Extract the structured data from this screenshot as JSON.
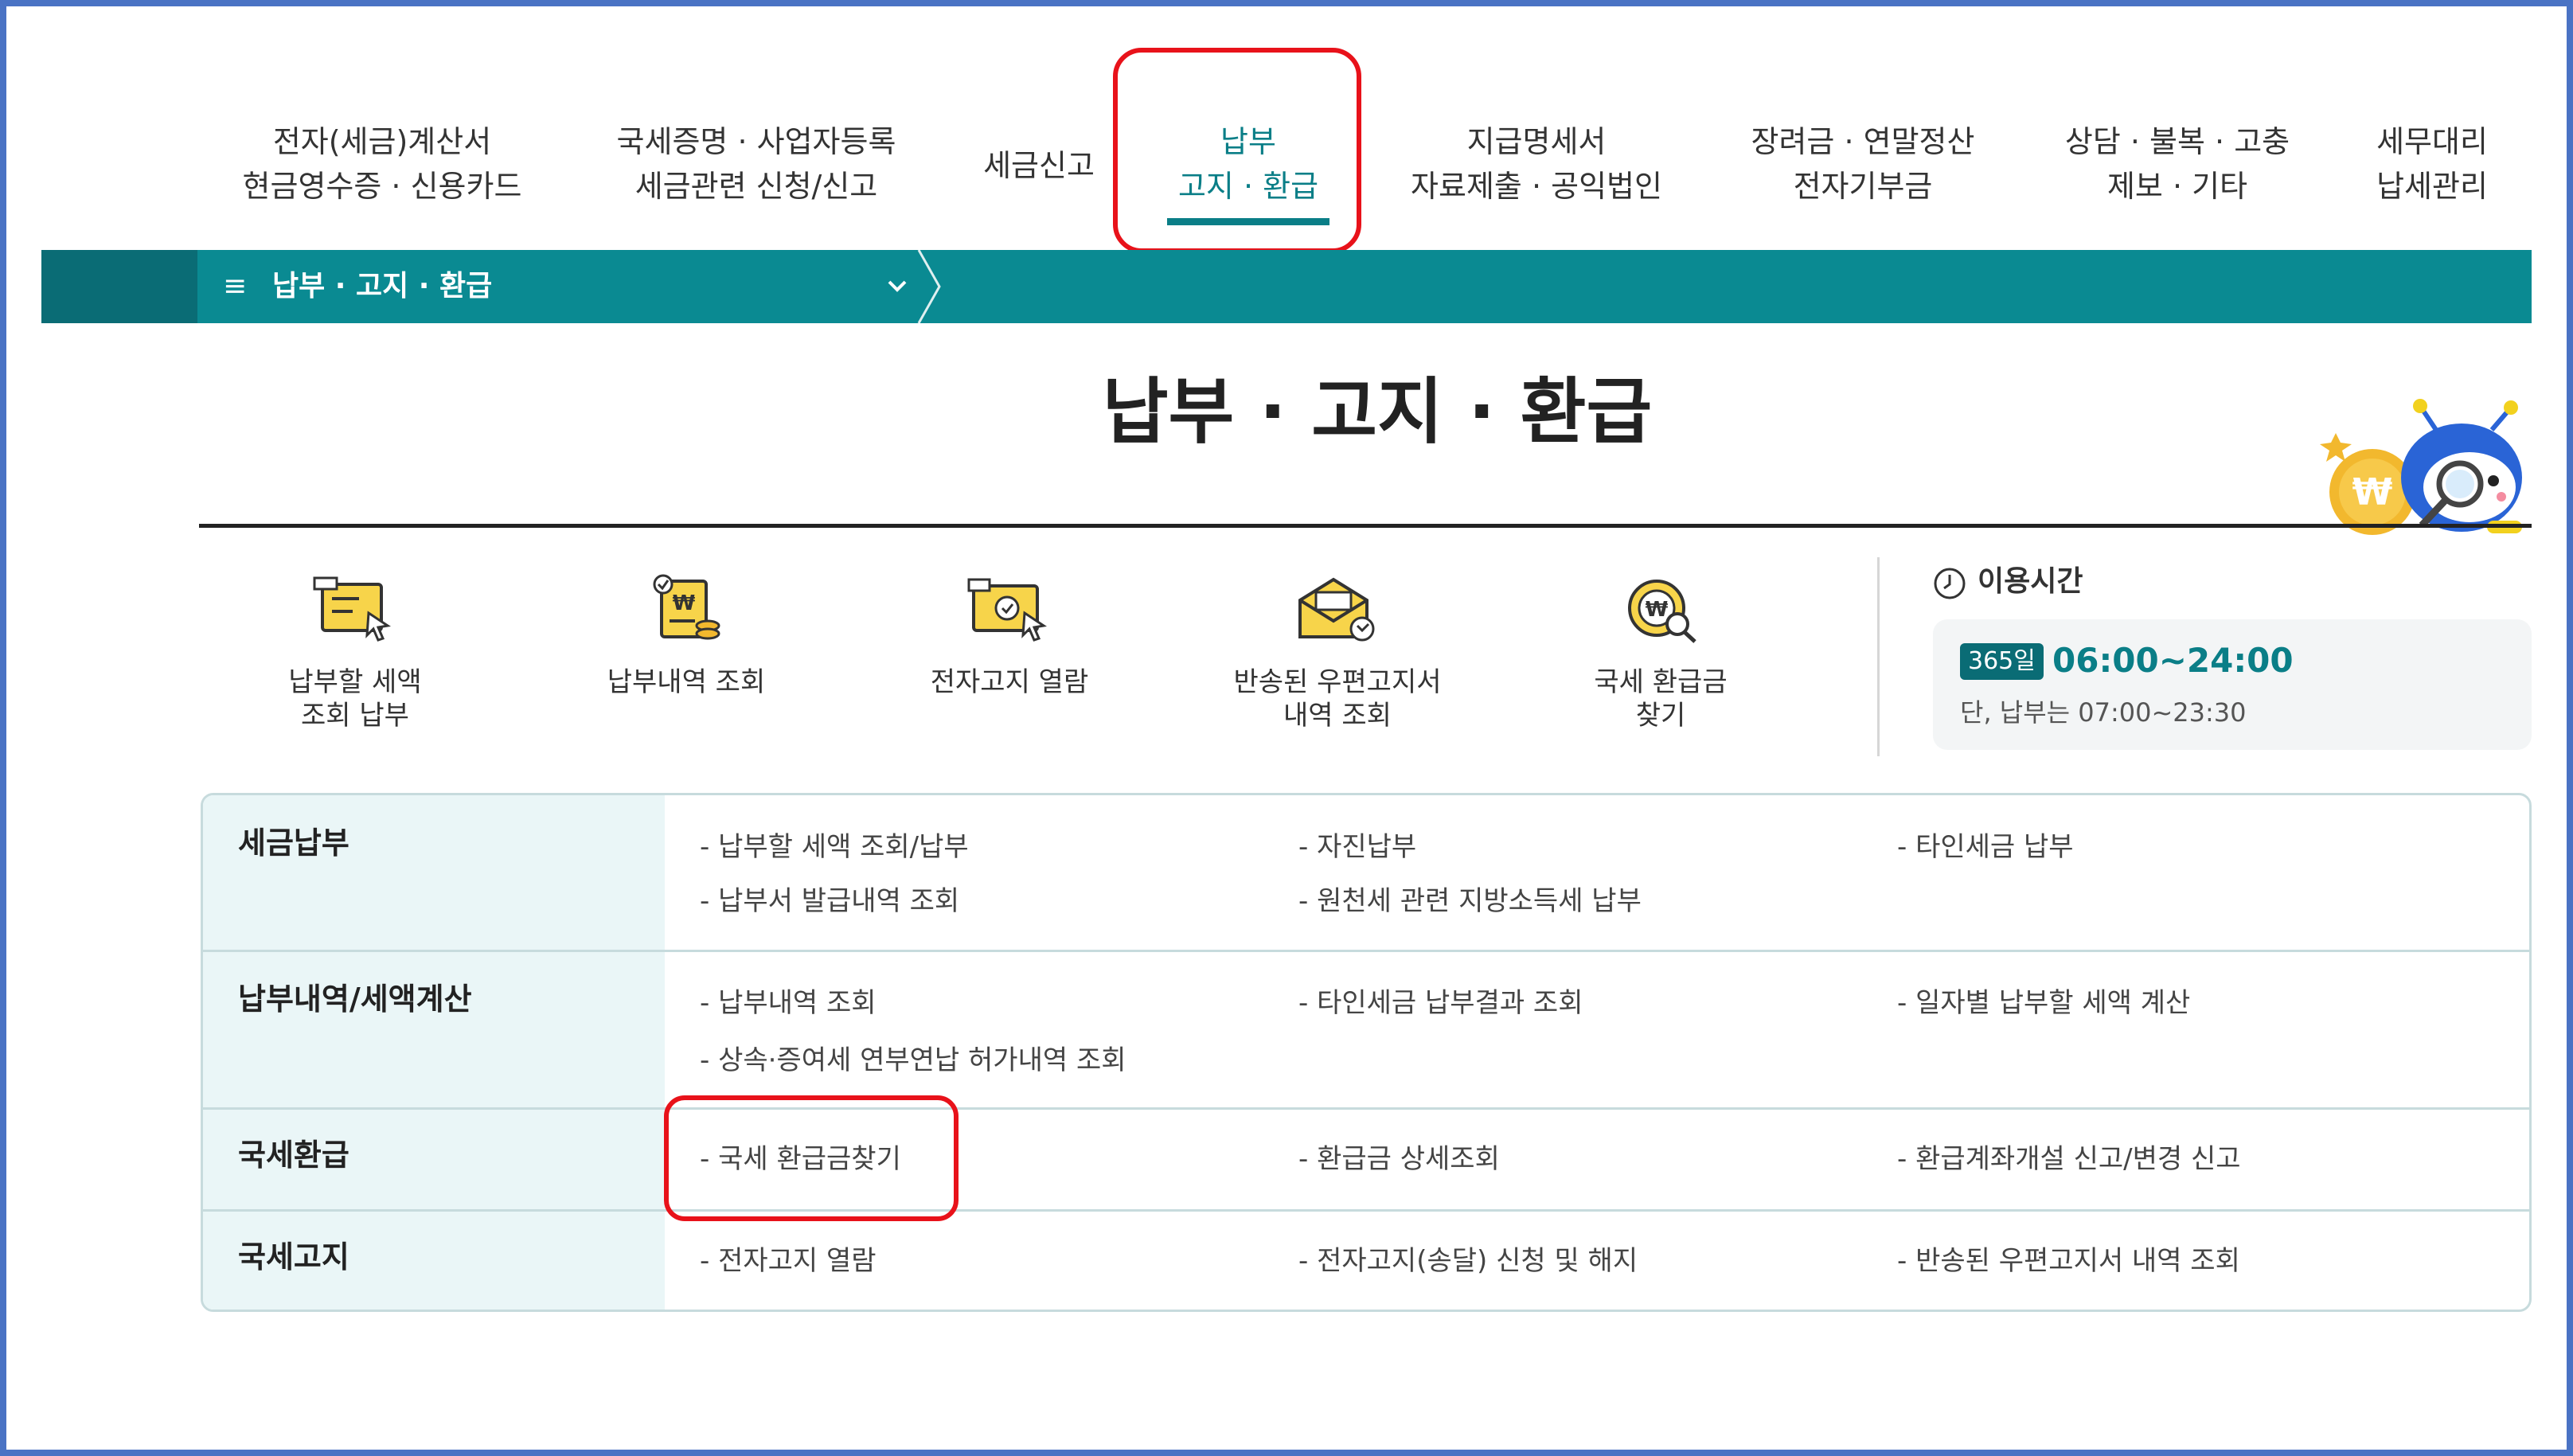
{
  "nav": {
    "items": [
      {
        "line1": "전자(세금)계산서",
        "line2": "현금영수증 · 신용카드"
      },
      {
        "line1": "국세증명 · 사업자등록",
        "line2": "세금관련 신청/신고"
      },
      {
        "line1": "세금신고",
        "line2": ""
      },
      {
        "line1": "납부",
        "line2": "고지 · 환급"
      },
      {
        "line1": "지급명세서",
        "line2": "자료제출 · 공익법인"
      },
      {
        "line1": "장려금 · 연말정산",
        "line2": "전자기부금"
      },
      {
        "line1": "상담 · 불복 · 고충",
        "line2": "제보 · 기타"
      },
      {
        "line1": "세무대리",
        "line2": "납세관리"
      }
    ],
    "active_index": 3
  },
  "menu_bar": {
    "icon": "≡",
    "label": "납부 · 고지 · 환급"
  },
  "page_title": "납부 · 고지 · 환급",
  "quick_links": [
    {
      "line1": "납부할 세액",
      "line2": "조회 납부",
      "icon": "tax-invoice-icon"
    },
    {
      "line1": "납부내역 조회",
      "line2": "",
      "icon": "payment-history-icon"
    },
    {
      "line1": "전자고지 열람",
      "line2": "",
      "icon": "e-notice-icon"
    },
    {
      "line1": "반송된 우편고지서",
      "line2": "내역 조회",
      "icon": "returned-mail-icon"
    },
    {
      "line1": "국세 환급금",
      "line2": "찾기",
      "icon": "refund-search-icon"
    }
  ],
  "hours": {
    "heading": "이용시간",
    "badge": "365일",
    "time": "06:00~24:00",
    "note": "단, 납부는 07:00~23:30"
  },
  "table": [
    {
      "title": "세금납부",
      "items": [
        "- 납부할 세액 조회/납부",
        "- 자진납부",
        "- 타인세금 납부",
        "- 납부서 발급내역 조회",
        "- 원천세 관련 지방소득세 납부"
      ]
    },
    {
      "title": "납부내역/세액계산",
      "items": [
        "- 납부내역 조회",
        "- 타인세금 납부결과 조회",
        "- 일자별 납부할 세액 계산",
        "- 상속·증여세 연부연납 허가내역 조회"
      ]
    },
    {
      "title": "국세환급",
      "items": [
        "- 국세 환급금찾기",
        "- 환급금 상세조회",
        "- 환급계좌개설 신고/변경 신고"
      ]
    },
    {
      "title": "국세고지",
      "items": [
        "- 전자고지 열람",
        "- 전자고지(송달) 신청 및 해지",
        "- 반송된 우편고지서 내역 조회"
      ]
    }
  ],
  "colors": {
    "teal": "#0a8a92",
    "teal_dark": "#0a6c75",
    "highlight": "#e8121a",
    "frame": "#4a73c4"
  }
}
